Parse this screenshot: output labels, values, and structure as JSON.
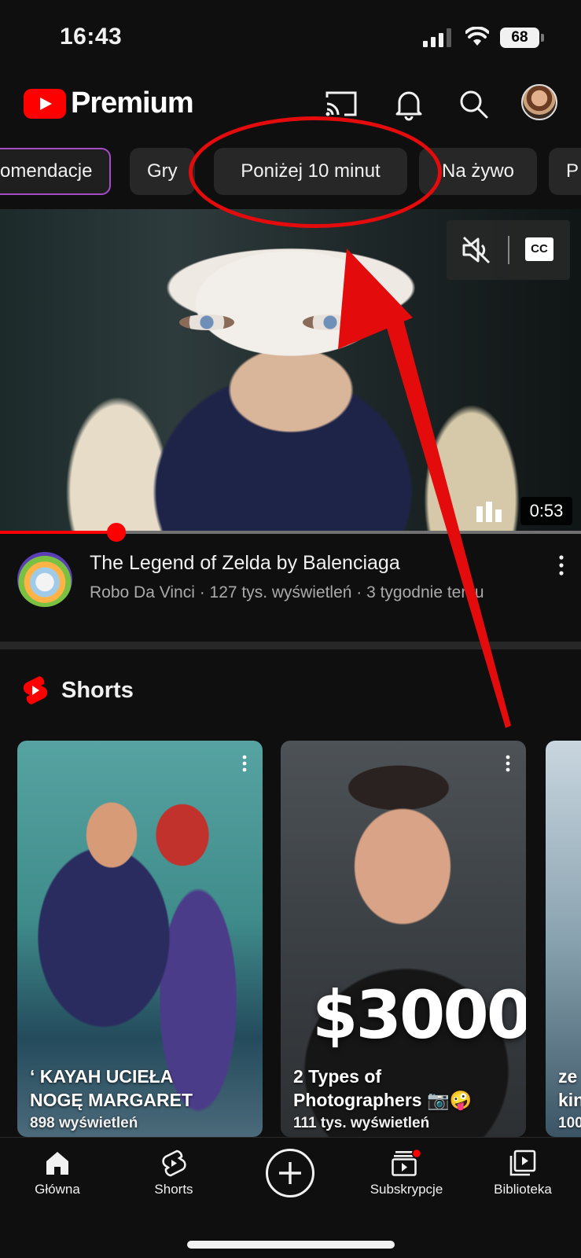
{
  "status_bar": {
    "time": "16:43",
    "battery": "68"
  },
  "header": {
    "brand": "Premium"
  },
  "chips": [
    {
      "label": "omendacje"
    },
    {
      "label": "Gry"
    },
    {
      "label": "Poniżej 10 minut"
    },
    {
      "label": "Na żywo"
    },
    {
      "label": "P"
    }
  ],
  "video": {
    "duration": "0:53",
    "cc_label": "CC",
    "progress": 0.2,
    "title": "The Legend of Zelda by Balenciaga",
    "subtitle": "Robo Da Vinci · 127 tys. wyświetleń · 3 tygodnie temu"
  },
  "shorts": {
    "section_title": "Shorts",
    "items": [
      {
        "caption_1": "‘ KAYAH UCIEŁA",
        "caption_2": "NOGĘ MARGARET",
        "views": "898 wyświetleń"
      },
      {
        "overlay": "$3000",
        "caption_1": "2 Types of",
        "caption_2": "Photographers 📷🤪",
        "views": "111 tys. wyświetleń"
      },
      {
        "caption_1": "ze",
        "caption_2": "kin",
        "views": "100"
      }
    ]
  },
  "bottom_nav": {
    "home": "Główna",
    "shorts": "Shorts",
    "subscriptions": "Subskrypcje",
    "library": "Biblioteka"
  },
  "colors": {
    "accent": "#ff0000",
    "annotation": "#e30b0b",
    "background": "#0f0f0f",
    "chip": "#272727"
  }
}
